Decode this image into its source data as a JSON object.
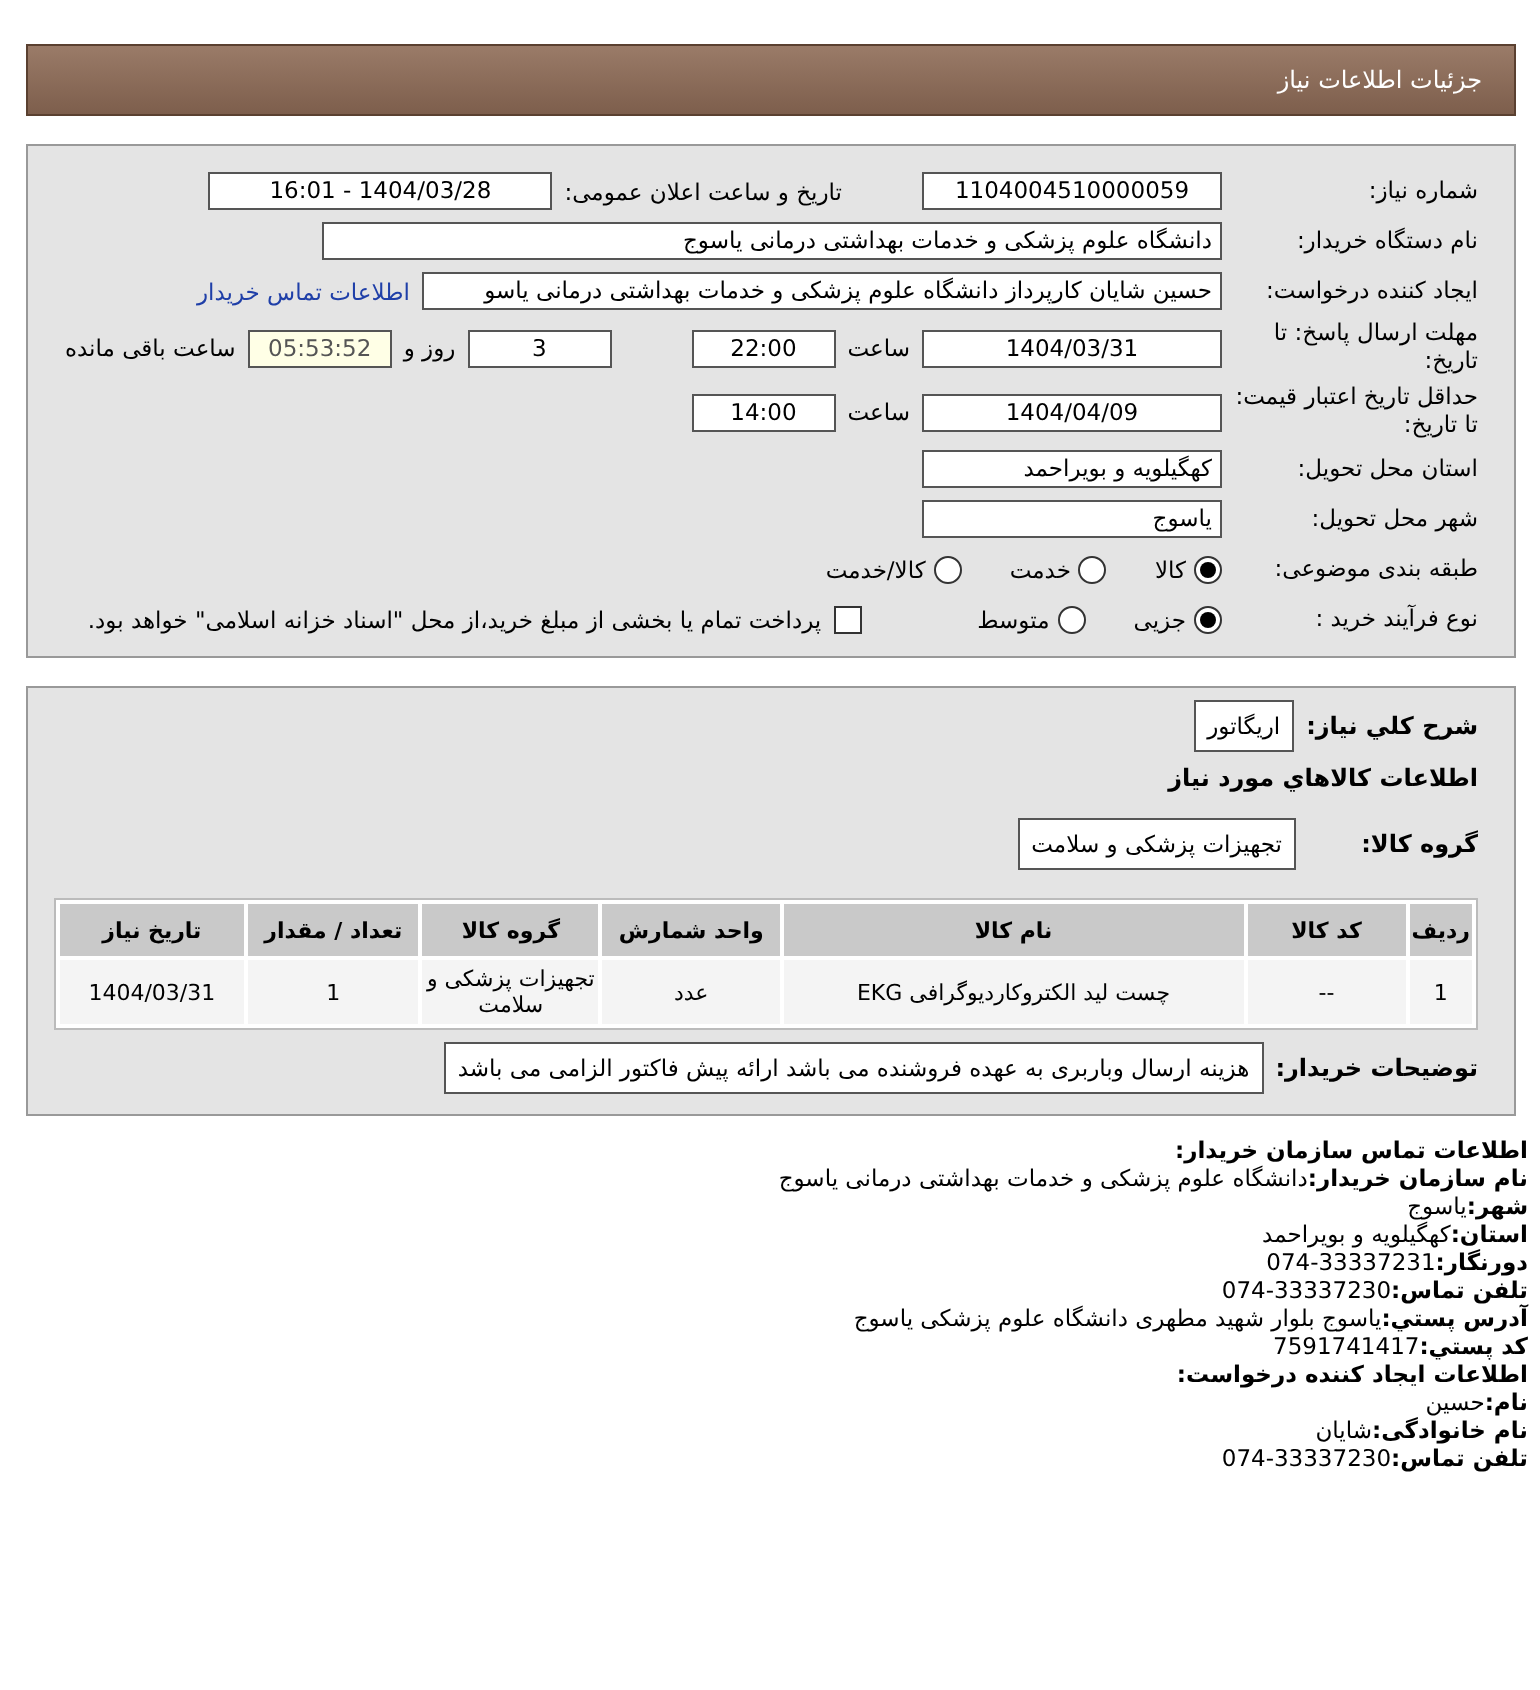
{
  "header": {
    "title": "جزئیات اطلاعات نیاز"
  },
  "details": {
    "need_number": {
      "label": "شماره نیاز:",
      "value": "1104004510000059"
    },
    "announce": {
      "label": "تاریخ و ساعت اعلان عمومی:",
      "value": "1404/03/28 - 16:01"
    },
    "buyer": {
      "label": "نام دستگاه خریدار:",
      "value": "دانشگاه علوم پزشکی و خدمات بهداشتی  درمانی یاسوج"
    },
    "creator": {
      "label": "ایجاد کننده درخواست:",
      "value": "حسین شایان کارپرداز دانشگاه علوم پزشکی و خدمات بهداشتی  درمانی یاسو",
      "link": "اطلاعات تماس خریدار"
    },
    "deadline": {
      "label": "مهلت ارسال پاسخ: تا تاریخ:",
      "date": "1404/03/31",
      "time_label": "ساعت",
      "time": "22:00",
      "days": "3",
      "days_label": "روز و",
      "remaining": "05:53:52",
      "remaining_label": "ساعت باقی مانده"
    },
    "validity": {
      "label": "حداقل تاریخ اعتبار قیمت: تا تاریخ:",
      "date": "1404/04/09",
      "time_label": "ساعت",
      "time": "14:00"
    },
    "province": {
      "label": "استان محل تحویل:",
      "value": "کهگیلویه و بویراحمد"
    },
    "city": {
      "label": "شهر محل تحویل:",
      "value": "یاسوج"
    },
    "category": {
      "label": "طبقه بندی موضوعی:",
      "options": [
        {
          "label": "کالا",
          "selected": true
        },
        {
          "label": "خدمت",
          "selected": false
        },
        {
          "label": "کالا/خدمت",
          "selected": false
        }
      ]
    },
    "process": {
      "label": "نوع فرآیند خرید :",
      "options": [
        {
          "label": "جزیی",
          "selected": true
        },
        {
          "label": "متوسط",
          "selected": false
        }
      ],
      "payment": {
        "checked": false,
        "label": "پرداخت تمام یا بخشی از مبلغ خرید،از محل \"اسناد خزانه اسلامی\" خواهد بود."
      }
    }
  },
  "goods": {
    "summary": {
      "label": "شرح کلي نیاز:",
      "value": "اریگاتور"
    },
    "section_title": "اطلاعات کالاهاي مورد نیاز",
    "group": {
      "label": "گروه کالا:",
      "value": "تجهیزات پزشکی و سلامت"
    },
    "table": {
      "columns": [
        "ردیف",
        "کد کالا",
        "نام کالا",
        "واحد شمارش",
        "گروه کالا",
        "تعداد / مقدار",
        "تاریخ نیاز"
      ],
      "rows": [
        [
          "1",
          "--",
          "چست لید الکتروکاردیوگرافی EKG",
          "عدد",
          "تجهیزات پزشکی و سلامت",
          "1",
          "1404/03/31"
        ]
      ]
    },
    "notes": {
      "label": "توضیحات خریدار:",
      "value": "هزینه ارسال وباربری به عهده فروشنده می باشد ارائه پیش فاکتور الزامی می باشد"
    }
  },
  "contact": [
    {
      "label": "اطلاعات تماس سازمان خریدار:"
    },
    {
      "label": "نام سازمان خریدار:",
      "value": "دانشگاه علوم پزشکی و خدمات بهداشتی درمانی یاسوج"
    },
    {
      "label": "شهر:",
      "value": "یاسوج"
    },
    {
      "label": "استان:",
      "value": "کهگیلویه و بویراحمد"
    },
    {
      "label": "دورنگار:",
      "value": "33337231-074"
    },
    {
      "label": "تلفن تماس:",
      "value": "33337230-074"
    },
    {
      "label": "آدرس پستي:",
      "value": "یاسوج بلوار شهید مطهری دانشگاه علوم پزشکی یاسوج"
    },
    {
      "label": "کد پستي:",
      "value": "7591741417"
    },
    {
      "label": "اطلاعات ایجاد کننده درخواست:"
    },
    {
      "label": "نام:",
      "value": "حسین"
    },
    {
      "label": "نام خانوادگی:",
      "value": "شایان"
    },
    {
      "label": "تلفن تماس:",
      "value": "33337230-074"
    }
  ]
}
